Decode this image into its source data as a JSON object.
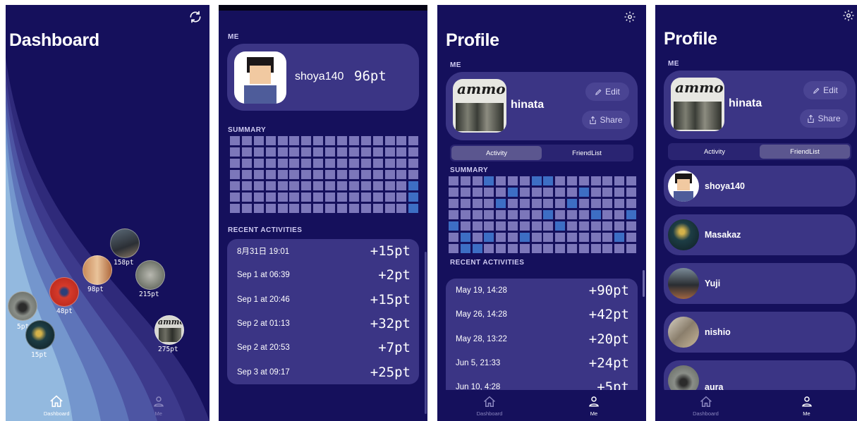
{
  "colors": {
    "bg": "#15105c",
    "card": "#3b3585",
    "cell": "#7c77ba",
    "cell_hi": "#3d6ec4"
  },
  "tabbar": {
    "dashboard_label": "Dashboard",
    "me_label": "Me"
  },
  "screen1": {
    "title": "Dashboard",
    "refresh_icon": "refresh-icon",
    "bubbles": [
      {
        "label": "158pt",
        "kind": "photo-food"
      },
      {
        "label": "98pt",
        "kind": "photo-door"
      },
      {
        "label": "215pt",
        "kind": "photo-cat"
      },
      {
        "label": "48pt",
        "kind": "photo-red"
      },
      {
        "label": "5pt",
        "kind": "photo-bird"
      },
      {
        "label": "15pt",
        "kind": "photo-dark"
      },
      {
        "label": "275pt",
        "kind": "ammo-logo"
      }
    ]
  },
  "screen2": {
    "me_section": "ME",
    "username": "shoya140",
    "points": "96pt",
    "summary_section": "SUMMARY",
    "recent_section": "RECENT ACTIVITIES",
    "activities": [
      {
        "date": "8月31日 19:01",
        "pts": "+15pt"
      },
      {
        "date": "Sep 1 at 06:39",
        "pts": "+2pt"
      },
      {
        "date": "Sep 1 at 20:46",
        "pts": "+15pt"
      },
      {
        "date": "Sep 2 at 01:13",
        "pts": "+32pt"
      },
      {
        "date": "Sep 2 at 20:53",
        "pts": "+7pt"
      },
      {
        "date": "Sep 3 at 09:17",
        "pts": "+25pt"
      }
    ]
  },
  "screen3": {
    "title": "Profile",
    "me_section": "ME",
    "username": "hinata",
    "logo_text": "ammo",
    "edit_label": "Edit",
    "share_label": "Share",
    "tab_activity": "Activity",
    "tab_friendlist": "FriendList",
    "summary_section": "SUMMARY",
    "recent_section": "RECENT ACTIVITIES",
    "activities": [
      {
        "date": "May 19, 14:28",
        "pts": "+90pt"
      },
      {
        "date": "May 26, 14:28",
        "pts": "+42pt"
      },
      {
        "date": "May 28, 13:22",
        "pts": "+20pt"
      },
      {
        "date": "Jun 5, 21:33",
        "pts": "+24pt"
      },
      {
        "date": "Jun 10, 4:28",
        "pts": "+5pt"
      }
    ]
  },
  "screen4": {
    "title": "Profile",
    "me_section": "ME",
    "username": "hinata",
    "logo_text": "ammo",
    "edit_label": "Edit",
    "share_label": "Share",
    "tab_activity": "Activity",
    "tab_friendlist": "FriendList",
    "friends": [
      {
        "name": "shoya140",
        "avatar": "pixel-avatar"
      },
      {
        "name": "Masakaz",
        "avatar": "photo-bird"
      },
      {
        "name": "Yuji",
        "avatar": "photo-car"
      },
      {
        "name": "nishio",
        "avatar": "photo-room"
      },
      {
        "name": "aura",
        "avatar": "photo-bird"
      }
    ]
  }
}
